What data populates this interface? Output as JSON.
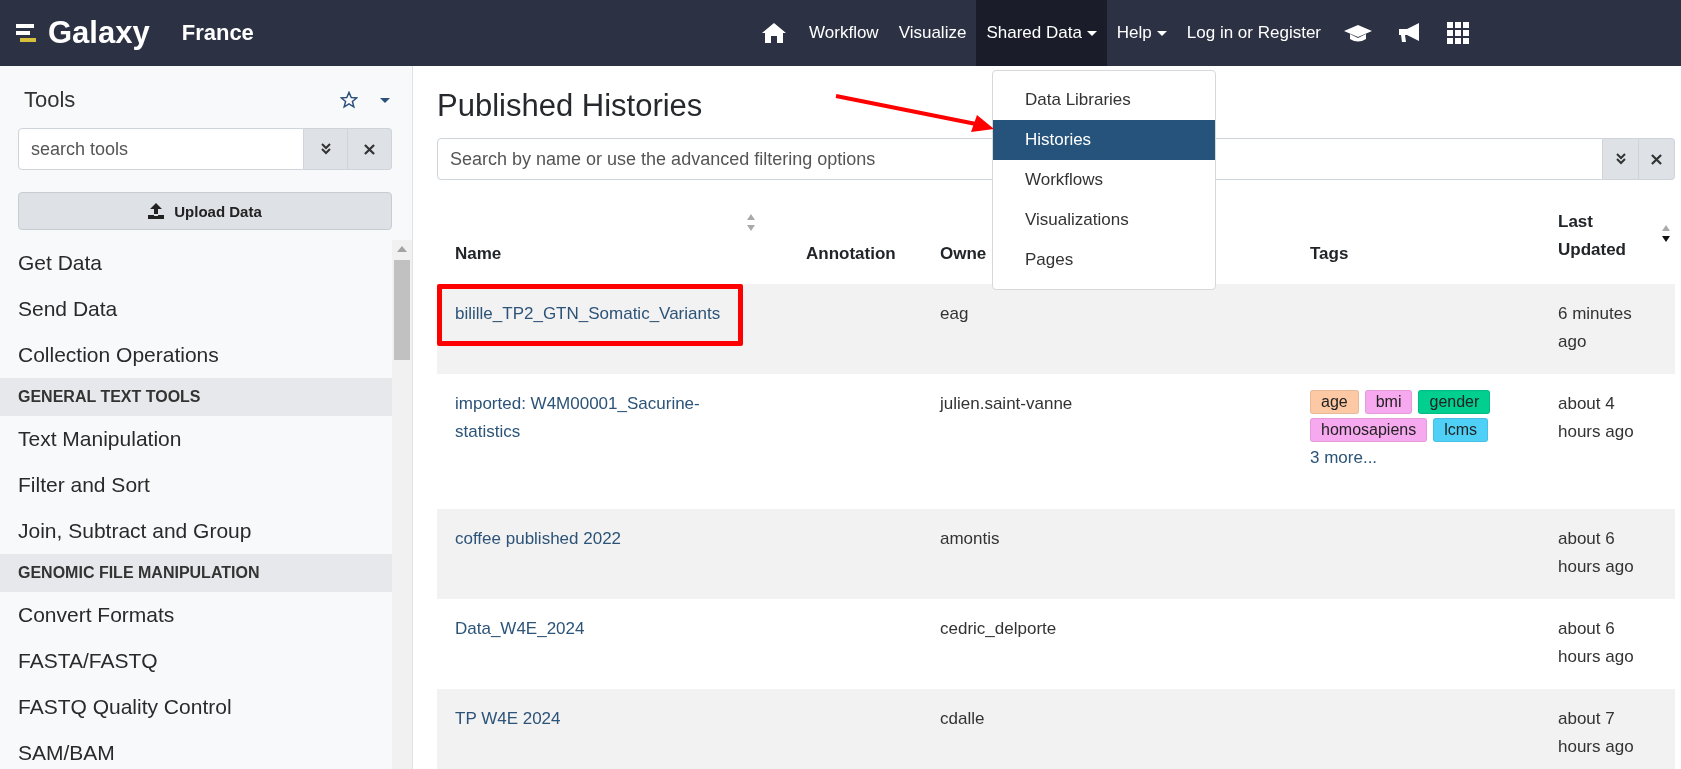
{
  "navbar": {
    "brand": "Galaxy",
    "subtitle": "France",
    "items": [
      {
        "label": "Workflow",
        "dropdown": false,
        "selected": false
      },
      {
        "label": "Visualize",
        "dropdown": false,
        "selected": false
      },
      {
        "label": "Shared Data",
        "dropdown": true,
        "selected": true
      },
      {
        "label": "Help",
        "dropdown": true,
        "selected": false
      },
      {
        "label": "Log in or Register",
        "dropdown": false,
        "selected": false
      }
    ]
  },
  "dropdown_menu": {
    "items": [
      {
        "label": "Data Libraries",
        "selected": false
      },
      {
        "label": "Histories",
        "selected": true
      },
      {
        "label": "Workflows",
        "selected": false
      },
      {
        "label": "Visualizations",
        "selected": false
      },
      {
        "label": "Pages",
        "selected": false
      }
    ]
  },
  "annotations": {
    "arrow": true,
    "highlight_box": true
  },
  "tool_panel": {
    "title": "Tools",
    "search": {
      "placeholder": "search tools"
    },
    "upload_button": "Upload Data",
    "items": [
      {
        "kind": "item",
        "label": "Get Data"
      },
      {
        "kind": "item",
        "label": "Send Data"
      },
      {
        "kind": "item",
        "label": "Collection Operations"
      },
      {
        "kind": "section",
        "label": "GENERAL TEXT TOOLS"
      },
      {
        "kind": "item",
        "label": "Text Manipulation"
      },
      {
        "kind": "item",
        "label": "Filter and Sort"
      },
      {
        "kind": "item",
        "label": "Join, Subtract and Group"
      },
      {
        "kind": "section",
        "label": "GENOMIC FILE MANIPULATION"
      },
      {
        "kind": "item",
        "label": "Convert Formats"
      },
      {
        "kind": "item",
        "label": "FASTA/FASTQ"
      },
      {
        "kind": "item",
        "label": "FASTQ Quality Control"
      },
      {
        "kind": "item",
        "label": "SAM/BAM"
      }
    ]
  },
  "main": {
    "title": "Published Histories",
    "search": {
      "placeholder": "Search by name or use the advanced filtering options"
    },
    "table": {
      "columns": [
        {
          "label": "Name",
          "sortable": true,
          "sorted": false
        },
        {
          "label": "Annotation",
          "sortable": false,
          "sorted": false
        },
        {
          "label": "Owne",
          "sortable": false,
          "sorted": false
        },
        {
          "label": "Tags",
          "sortable": false,
          "sorted": false
        },
        {
          "label": "Last Updated",
          "sortable": true,
          "sorted": true
        }
      ],
      "rows": [
        {
          "name": "bilille_TP2_GTN_Somatic_Variants",
          "owner": "eag",
          "tags": [],
          "updated": "6 minutes ago"
        },
        {
          "name": "imported: W4M00001_Sacurine-statistics",
          "owner": "julien.saint-vanne",
          "tags": [
            {
              "label": "age",
              "color": "#fcc9a4"
            },
            {
              "label": "bmi",
              "color": "#f7a9ef"
            },
            {
              "label": "gender",
              "color": "#00cf8f"
            },
            {
              "label": "homosapiens",
              "color": "#f7a9ef"
            },
            {
              "label": "lcms",
              "color": "#4fd1f7"
            }
          ],
          "more": "3 more...",
          "updated": "about 4 hours ago"
        },
        {
          "name": "coffee published 2022",
          "owner": "amontis",
          "tags": [],
          "updated": "about 6 hours ago"
        },
        {
          "name": "Data_W4E_2024",
          "owner": "cedric_delporte",
          "tags": [],
          "updated": "about 6 hours ago"
        },
        {
          "name": "TP W4E 2024",
          "owner": "cdalle",
          "tags": [],
          "updated": "about 7 hours ago"
        }
      ]
    }
  }
}
